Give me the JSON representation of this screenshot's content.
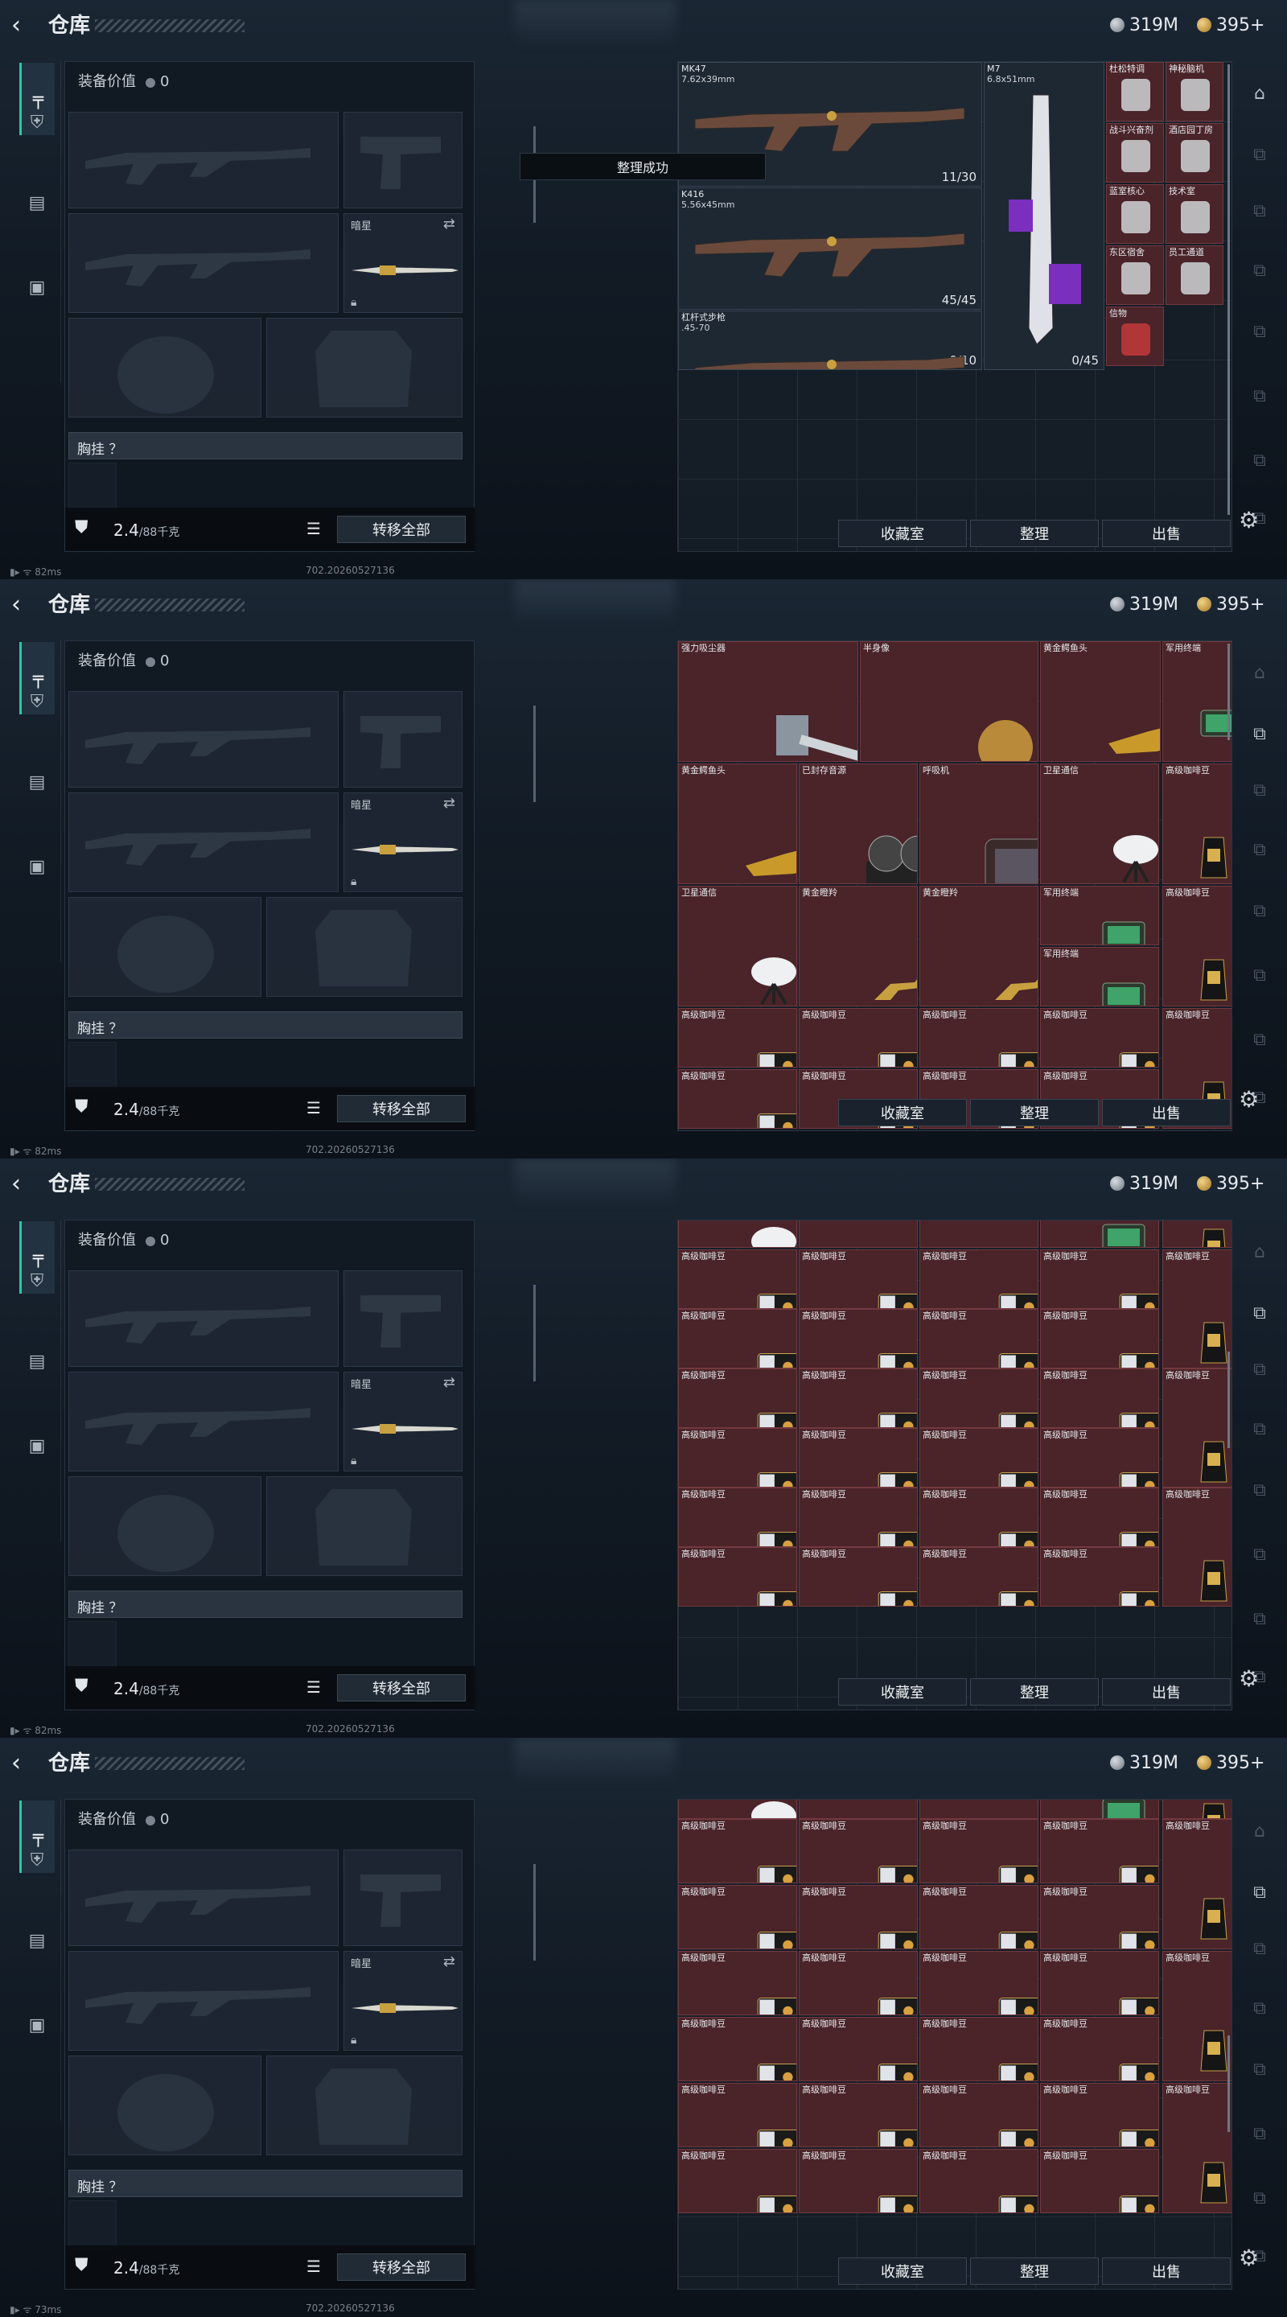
{
  "top": {
    "back_icon": "‹",
    "title": "仓库",
    "currency1": "319M",
    "currency2": "395+"
  },
  "left": {
    "equip_value_label": "装备价值",
    "equip_value": "0",
    "sidearm_name": "暗星",
    "chest_rig_label": "胸挂 ？",
    "weight_main": "2.4",
    "weight_max": "/88千克",
    "transfer_all": "转移全部"
  },
  "status": [
    {
      "ping": "82ms",
      "build": "702.20260527136"
    },
    {
      "ping": "82ms",
      "build": "702.20260527136"
    },
    {
      "ping": "82ms",
      "build": "702.20260527136"
    },
    {
      "ping": "73ms",
      "build": "702.20260527136"
    }
  ],
  "buttons": {
    "collection": "收藏室",
    "organize": "整理",
    "sell": "出售"
  },
  "toast": "整理成功",
  "frame1": {
    "guns": [
      {
        "name": "MK47",
        "cal": "7.62x39mm",
        "ammo": "11/30"
      },
      {
        "name": "K416",
        "cal": "5.56x45mm",
        "ammo": "45/45"
      },
      {
        "name": "杠杆式步枪",
        "cal": ".45-70",
        "ammo": "0/10"
      },
      {
        "name": "M7",
        "cal": "6.8x51mm",
        "ammo": "0/45"
      }
    ],
    "small": [
      "杜松特调",
      "神秘脑机",
      "战斗兴奋剂",
      "酒店园丁房",
      "蓝室核心",
      "技术室",
      "东区宿舍",
      "员工通道",
      "信物"
    ]
  },
  "frame2": {
    "items": [
      {
        "name": "强力吸尘器"
      },
      {
        "name": "半身像"
      },
      {
        "name": "黄金鳄鱼头"
      },
      {
        "name": "军用终端"
      },
      {
        "name": "黄金鳄鱼头"
      },
      {
        "name": "已封存音源"
      },
      {
        "name": "呼吸机"
      },
      {
        "name": "卫星通信"
      },
      {
        "name": "高级咖啡豆"
      },
      {
        "name": "卫星通信"
      },
      {
        "name": "黄金瞪羚"
      },
      {
        "name": "黄金瞪羚"
      },
      {
        "name": "军用终端"
      },
      {
        "name": "高级咖啡豆"
      },
      {
        "name": "军用终端"
      },
      {
        "name": "高级咖啡豆"
      }
    ]
  },
  "coffee_label": "高级咖啡豆",
  "terminal_label": "军用终端"
}
